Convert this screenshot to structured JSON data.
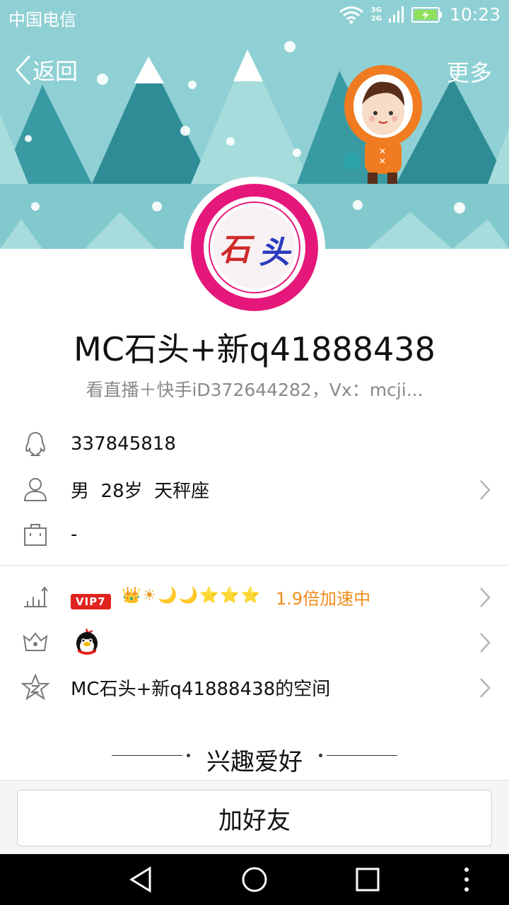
{
  "status_bar": {
    "carrier": "中国电信",
    "network_top": "3G",
    "network_bottom": "2G",
    "time": "10:23"
  },
  "nav": {
    "back_label": "返回",
    "more_label": "更多"
  },
  "profile": {
    "name": "MC石头+新q41888438",
    "signature": "看直播＋快手iD372644282，Vx：mcji...",
    "avatar_text_left": "石",
    "avatar_text_right": "头"
  },
  "info": {
    "qq_number": "337845818",
    "gender": "男",
    "age": "28岁",
    "zodiac": "天秤座",
    "company": "-"
  },
  "vip": {
    "badge": "VIP7",
    "level_icons": [
      "👑",
      "☀",
      "🌙",
      "🌙",
      "⭐",
      "⭐",
      "⭐"
    ],
    "speed_text": "1.9倍加速中"
  },
  "space": {
    "label": "MC石头+新q41888438的空间"
  },
  "hobbies": {
    "title": "兴趣爱好"
  },
  "actions": {
    "add_friend_label": "加好友"
  },
  "colors": {
    "banner_bg": "#8fd0d4",
    "vip_red": "#e0231f",
    "accent_orange": "#f08c1a",
    "avatar_pink": "#e5177a"
  }
}
